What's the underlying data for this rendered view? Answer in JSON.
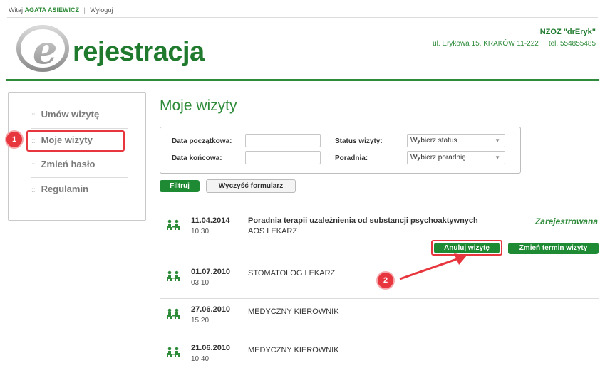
{
  "topbar": {
    "greeting": "Witaj",
    "user": "AGATA ASIEWICZ",
    "separator": "|",
    "logout": "Wyloguj"
  },
  "logo": {
    "text": "rejestracja",
    "letter": "e"
  },
  "clinic": {
    "name": "NZOZ \"drEryk\"",
    "address": "ul. Erykowa 15, KRAKÓW 11-222",
    "phone": "tel. 554855485"
  },
  "sidebar": {
    "items": [
      {
        "label": "Umów wizytę"
      },
      {
        "label": "Moje wizyty"
      },
      {
        "label": "Zmień hasło"
      },
      {
        "label": "Regulamin"
      }
    ],
    "dots": "::"
  },
  "annotations": {
    "badge1": "1",
    "badge2": "2"
  },
  "main": {
    "title": "Moje wizyty"
  },
  "filters": {
    "start_label": "Data początkowa:",
    "end_label": "Data końcowa:",
    "start_value": "",
    "end_value": "",
    "status_label": "Status wizyty:",
    "status_value": "Wybierz status",
    "clinic_label": "Poradnia:",
    "clinic_value": "Wybierz poradnię",
    "filter_button": "Filtruj",
    "clear_button": "Wyczyść formularz"
  },
  "visits": [
    {
      "date": "11.04.2014",
      "time": "10:30",
      "clinic": "Poradnia terapii uzależnienia od substancji psychoaktywnych",
      "doctor": "AOS LEKARZ",
      "status": "Zarejestrowana",
      "cancel_label": "Anuluj wizytę",
      "reschedule_label": "Zmień termin wizyty"
    },
    {
      "date": "01.07.2010",
      "time": "03:10",
      "doctor": "STOMATOLOG LEKARZ"
    },
    {
      "date": "27.06.2010",
      "time": "15:20",
      "doctor": "MEDYCZNY KIEROWNIK"
    },
    {
      "date": "21.06.2010",
      "time": "10:40",
      "doctor": "MEDYCZNY KIEROWNIK"
    }
  ],
  "colors": {
    "brand_green": "#2e8b3a",
    "button_green": "#1f8a34",
    "annotation_red": "#e8363e"
  }
}
